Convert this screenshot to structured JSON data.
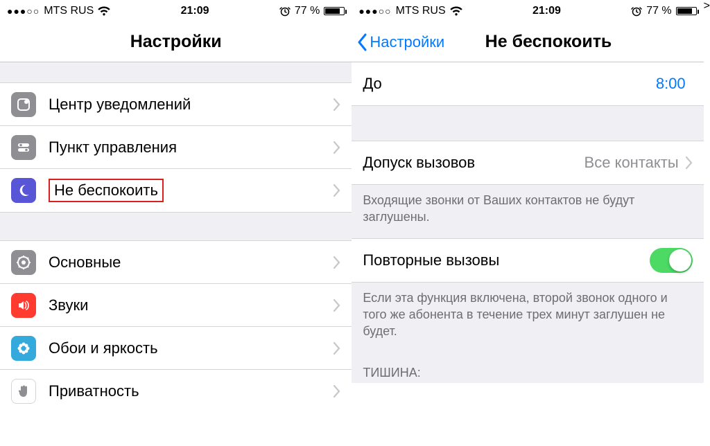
{
  "status": {
    "carrier": "MTS RUS",
    "time": "21:09",
    "battery": "77 %",
    "signal": "●●●○○"
  },
  "left": {
    "title": "Настройки",
    "rows": {
      "notification": "Центр уведомлений",
      "control": "Пункт управления",
      "dnd": "Не беспокоить",
      "general": "Основные",
      "sounds": "Звуки",
      "wallpaper": "Обои и яркость",
      "privacy": "Приватность"
    }
  },
  "right": {
    "back": "Настройки",
    "title": "Не беспокоить",
    "until_label": "До",
    "until_value": "8:00",
    "allow_label": "Допуск вызовов",
    "allow_value": "Все контакты",
    "allow_note": "Входящие звонки от Ваших контактов не будут заглушены.",
    "repeat_label": "Повторные вызовы",
    "repeat_note": "Если эта функция включена, второй звонок одного и того же абонента в течение трех минут заглушен не будет.",
    "silence_head": "ТИШИНА:"
  }
}
